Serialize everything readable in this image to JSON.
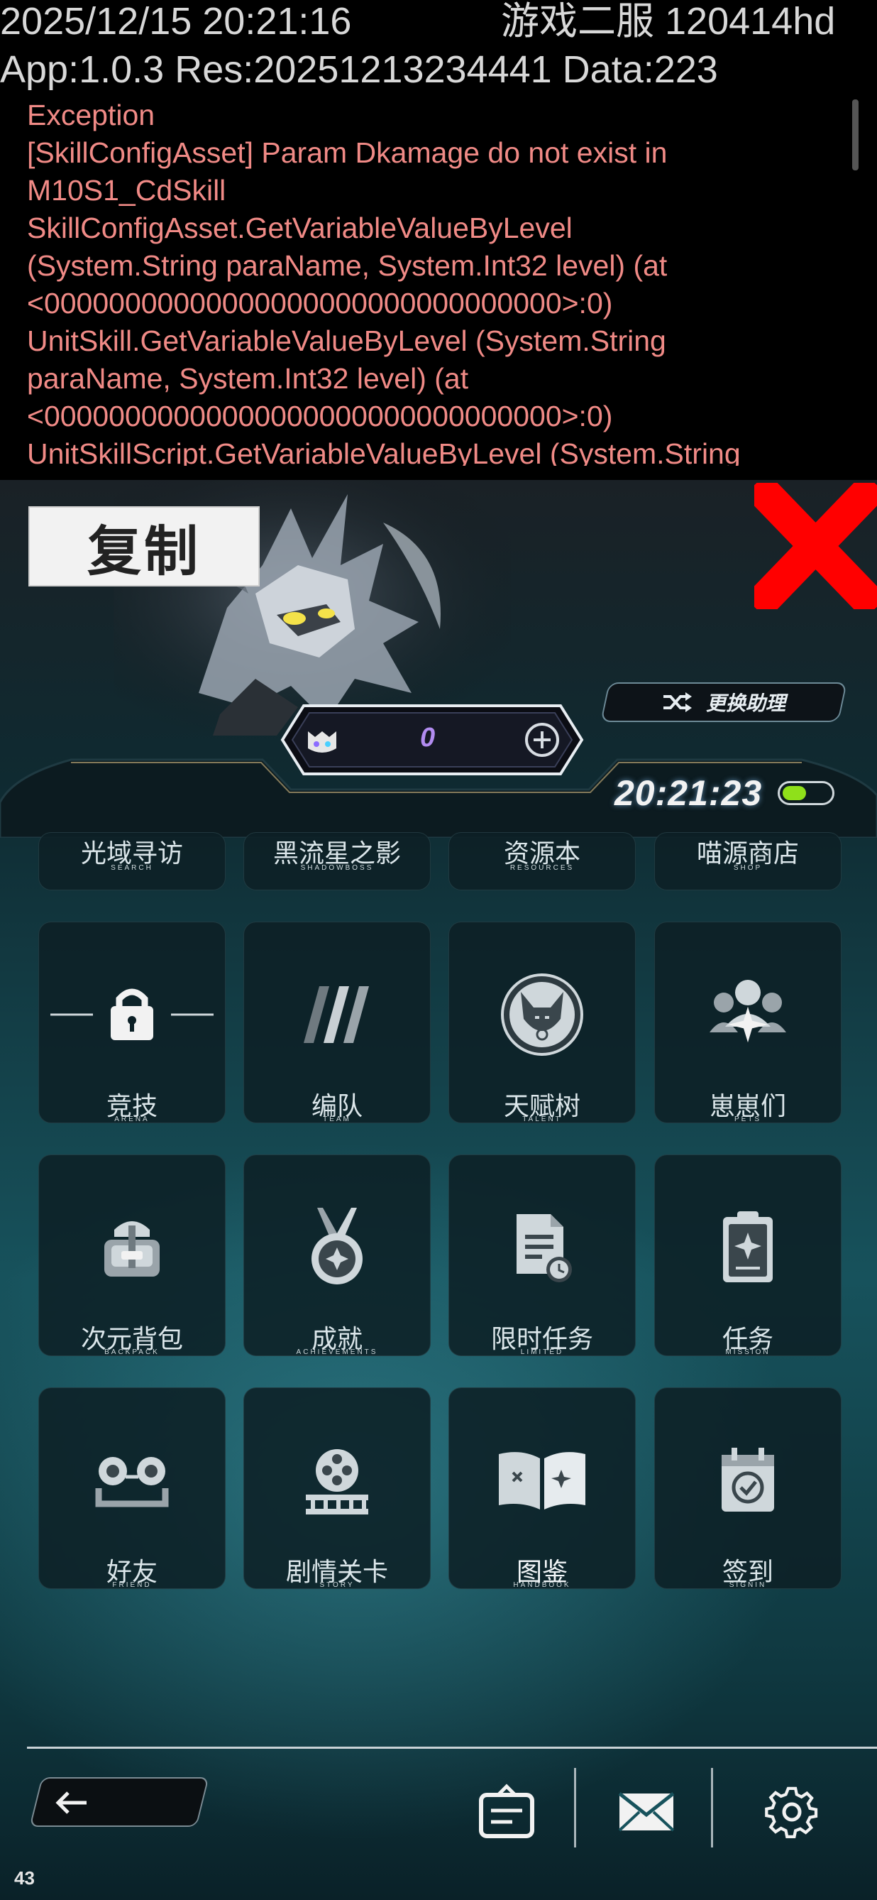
{
  "debug_header": {
    "timestamp": "2025/12/15 20:21:16",
    "server": "游戏二服 120414hd",
    "build_info": "App:1.0.3 Res:20251213234441 Data:223"
  },
  "log_lines": [
    "Exception",
    "[SkillConfigAsset] Param Dkamage do not exist in",
    "M10S1_CdSkill",
    "SkillConfigAsset.GetVariableValueByLevel",
    "(System.String paraName, System.Int32 level) (at",
    "<00000000000000000000000000000000>:0)",
    "UnitSkill.GetVariableValueByLevel (System.String",
    "paraName, System.Int32 level) (at",
    "<00000000000000000000000000000000>:0)",
    "UnitSkillScript.GetVariableValueByLevel (System.String"
  ],
  "copy_button": "复制",
  "change_assistant": "更换助理",
  "currency_value": "0",
  "clock": "20:21:23",
  "battery_level": 0.5,
  "top_row": [
    {
      "label": "光域寻访",
      "sub": "SEARCH"
    },
    {
      "label": "黑流星之影",
      "sub": "SHADOWBOSS"
    },
    {
      "label": "资源本",
      "sub": "RESOURCES"
    },
    {
      "label": "喵源商店",
      "sub": "SHOP"
    }
  ],
  "grid": [
    {
      "label": "竞技",
      "sub": "ARENA",
      "icon": "lock-icon"
    },
    {
      "label": "编队",
      "sub": "TEAM",
      "icon": "formation-icon"
    },
    {
      "label": "天赋树",
      "sub": "TALENT",
      "icon": "fox-emblem-icon"
    },
    {
      "label": "崽崽们",
      "sub": "PETS",
      "icon": "group-icon"
    },
    {
      "label": "次元背包",
      "sub": "BACKPACK",
      "icon": "backpack-icon"
    },
    {
      "label": "成就",
      "sub": "ACHIEVEMENTS",
      "icon": "medal-icon"
    },
    {
      "label": "限时任务",
      "sub": "LIMITED",
      "icon": "timed-task-icon"
    },
    {
      "label": "任务",
      "sub": "MISSION",
      "icon": "clipboard-icon"
    },
    {
      "label": "好友",
      "sub": "FRIEND",
      "icon": "friends-icon"
    },
    {
      "label": "剧情关卡",
      "sub": "STORY",
      "icon": "film-reel-icon"
    },
    {
      "label": "图鉴",
      "sub": "HANDBOOK",
      "icon": "open-book-icon"
    },
    {
      "label": "签到",
      "sub": "SIGNIN",
      "icon": "calendar-check-icon"
    }
  ],
  "bottom_bar": {
    "icons": [
      "back-arrow-icon",
      "notice-board-icon",
      "mail-icon",
      "settings-icon"
    ]
  },
  "fps": "43",
  "colors": {
    "log_text": "#f08a86",
    "close_x": "#ff0000",
    "battery": "#8fe01a",
    "currency": "#b28cf0"
  }
}
